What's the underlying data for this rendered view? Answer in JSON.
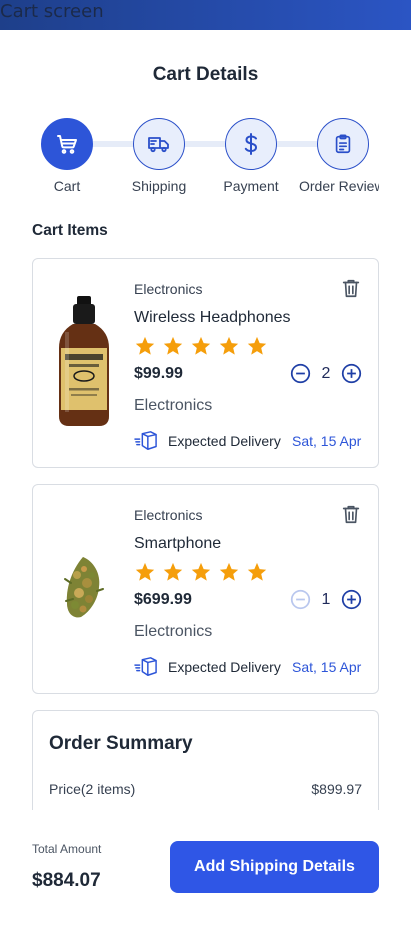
{
  "app": {
    "window_title": "Cart screen"
  },
  "page": {
    "title": "Cart Details"
  },
  "stepper": {
    "steps": [
      {
        "label": "Cart",
        "icon": "cart-icon",
        "active": true
      },
      {
        "label": "Shipping",
        "icon": "truck-icon",
        "active": false
      },
      {
        "label": "Payment",
        "icon": "dollar-icon",
        "active": false
      },
      {
        "label": "Order Review",
        "icon": "clipboard-icon",
        "active": false
      }
    ]
  },
  "cart": {
    "section_title": "Cart Items",
    "items": [
      {
        "category": "Electronics",
        "name": "Wireless Headphones",
        "rating": 5,
        "price": "$99.99",
        "quantity": "2",
        "sub_category": "Electronics",
        "delivery_label": "Expected Delivery",
        "delivery_date": "Sat, 15 Apr",
        "image": "cbd-oil-bottle",
        "minus_enabled": true
      },
      {
        "category": "Electronics",
        "name": "Smartphone",
        "rating": 5,
        "price": "$699.99",
        "quantity": "1",
        "sub_category": "Electronics",
        "delivery_label": "Expected Delivery",
        "delivery_date": "Sat, 15 Apr",
        "image": "cannabis-bud",
        "minus_enabled": false
      }
    ]
  },
  "summary": {
    "title": "Order Summary",
    "rows": [
      {
        "label": "Price(2 items)",
        "value": "$899.97"
      }
    ]
  },
  "footer": {
    "total_label": "Total Amount",
    "total_value": "$884.07",
    "cta_label": "Add Shipping Details"
  },
  "colors": {
    "primary": "#2f56e6",
    "star": "#f59e0b",
    "topbar": "#2b55c4",
    "delivery_date": "#2d55d8"
  }
}
